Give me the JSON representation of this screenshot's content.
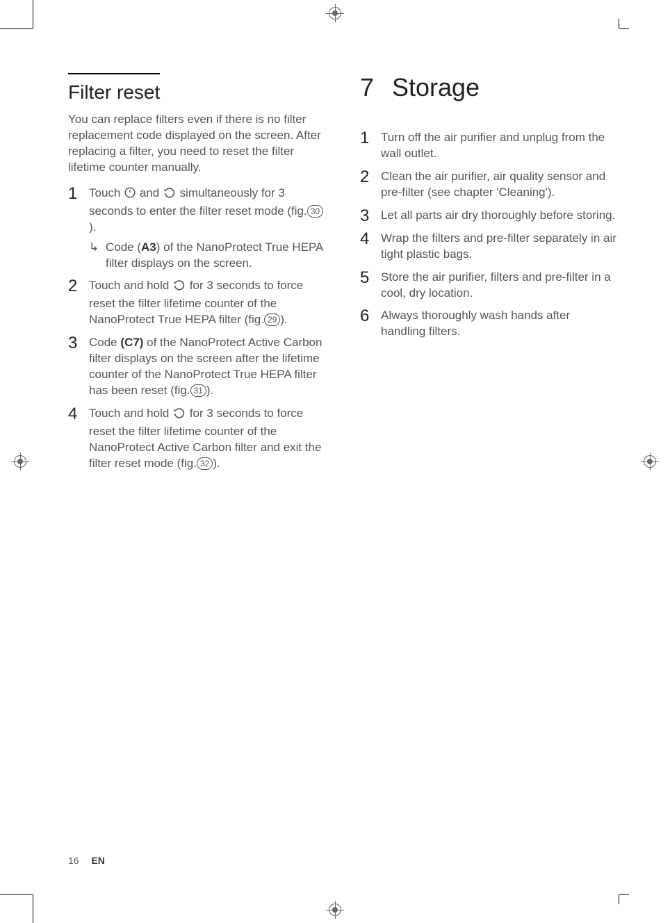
{
  "left": {
    "title": "Filter reset",
    "intro": "You can replace filters even if there is no filter replacement code displayed on the screen. After replacing a filter, you need to reset the filter lifetime counter manually.",
    "step1_a": "Touch ",
    "step1_b": " and ",
    "step1_c": " simultaneously for 3 seconds to enter the filter reset mode (fig.",
    "step1_fig": "30",
    "step1_d": ").",
    "step1_sub_a": "Code (",
    "step1_sub_code": "A3",
    "step1_sub_b": ") of the NanoProtect True HEPA filter displays on the screen.",
    "step2_a": "Touch and hold ",
    "step2_b": " for 3 seconds to force reset the filter lifetime counter of the NanoProtect True HEPA filter (fig.",
    "step2_fig": "29",
    "step2_c": ").",
    "step3_a": "Code ",
    "step3_code": "(C7)",
    "step3_b": " of the NanoProtect Active Carbon filter displays on the screen after the lifetime counter of the NanoProtect True HEPA filter has been reset (fig.",
    "step3_fig": "31",
    "step3_c": ").",
    "step4_a": "Touch and hold ",
    "step4_b": " for 3 seconds to force reset the filter lifetime counter of the NanoProtect Active Carbon filter and exit the filter reset mode (fig.",
    "step4_fig": "32",
    "step4_c": ")."
  },
  "right": {
    "chapter_num": "7",
    "chapter_title": "Storage",
    "steps": [
      "Turn off the air purifier and unplug from the wall outlet.",
      "Clean the air purifier, air quality sensor and pre-filter (see chapter 'Cleaning').",
      "Let all parts air dry thoroughly before storing.",
      " Wrap the filters and pre-filter separately in air tight plastic bags.",
      "Store the air purifier, filters and pre-filter in a cool, dry location.",
      "Always thoroughly wash hands after handling filters."
    ]
  },
  "footer": {
    "page": "16",
    "lang": "EN"
  },
  "icons": {
    "power": "power-icon",
    "reset": "reset-icon"
  }
}
